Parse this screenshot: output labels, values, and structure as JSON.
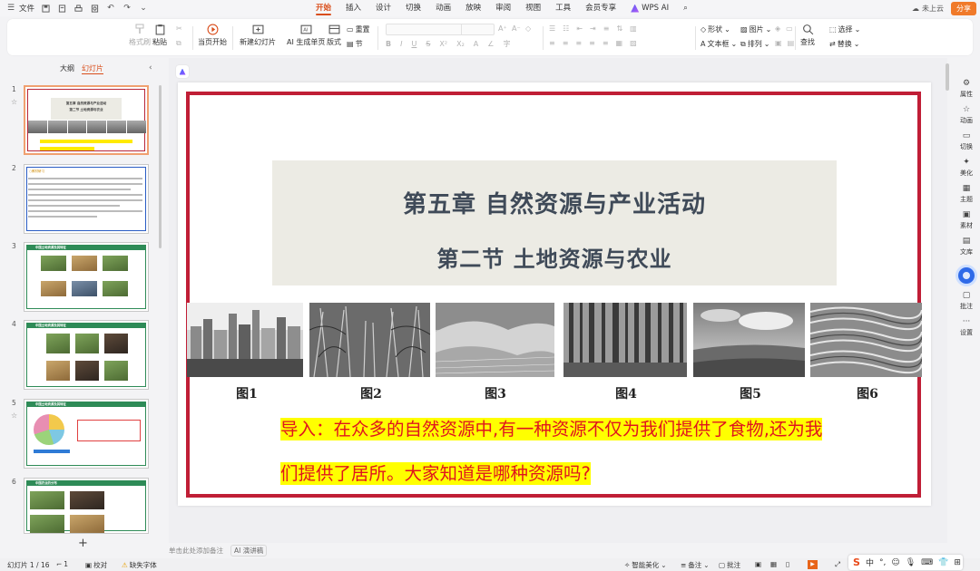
{
  "menubar": {
    "file_label": "文件",
    "tabs": [
      {
        "label": "开始",
        "active": true
      },
      {
        "label": "插入"
      },
      {
        "label": "设计"
      },
      {
        "label": "切换"
      },
      {
        "label": "动画"
      },
      {
        "label": "放映"
      },
      {
        "label": "审阅"
      },
      {
        "label": "视图"
      },
      {
        "label": "工具"
      },
      {
        "label": "会员专享"
      },
      {
        "label": "WPS AI"
      }
    ],
    "cloud_label": "未上云",
    "share_label": "分享"
  },
  "ribbon": {
    "format_painter": "格式刷",
    "paste": "粘贴",
    "play_from_current": "当页开始",
    "new_slide": "新建幻灯片",
    "ai_generate": "AI 生成单页",
    "layout": "版式",
    "section": "节",
    "reset": "重置",
    "shape": "形状",
    "picture": "图片",
    "textbox": "文本框",
    "arrange": "排列",
    "find": "查找",
    "select": "选择",
    "replace": "替换"
  },
  "left_panel": {
    "tab_outline": "大纲",
    "tab_slides": "幻灯片",
    "slide_numbers": [
      "1",
      "2",
      "3",
      "4",
      "5",
      "6"
    ],
    "thumb2_tag": "○教材研习",
    "thumb3_head": "中国土地资源及其特征",
    "thumb4_head": "中国土地资源及其特征",
    "thumb5_head": "中国土地资源及其特征",
    "thumb6_head": "中国农业的分布"
  },
  "slide": {
    "title_line1": "第五章  自然资源与产业活动",
    "title_line2": "第二节  土地资源与农业",
    "captions": [
      "图1",
      "图2",
      "图3",
      "图4",
      "图5",
      "图6"
    ],
    "intro_line1": "导入：在众多的自然资源中,有一种资源不仅为我们提供了食物,还为我",
    "intro_line2": "们提供了居所。大家知道是哪种资源吗?"
  },
  "right_sidebar": {
    "items": [
      "属性",
      "动画",
      "切换",
      "美化",
      "主题",
      "素材",
      "文库",
      "批注",
      "设置"
    ]
  },
  "notes": {
    "placeholder": "单击此处添加备注",
    "ai_script": "AI 演讲稿"
  },
  "statusbar": {
    "slide_counter": "幻灯片 1 / 16",
    "comment_count": "1",
    "proofread": "校对",
    "missing_font": "缺失字体",
    "smart_beautify": "智能美化",
    "notes_toggle": "备注",
    "comments_toggle": "批注"
  },
  "ime": {
    "mode": "中",
    "punct": "°,"
  },
  "colors": {
    "accent": "#d94d1a",
    "slide_border": "#c01e36",
    "title_text": "#3f4a58",
    "intro_text": "#e0141e",
    "highlight": "#ffff00"
  }
}
